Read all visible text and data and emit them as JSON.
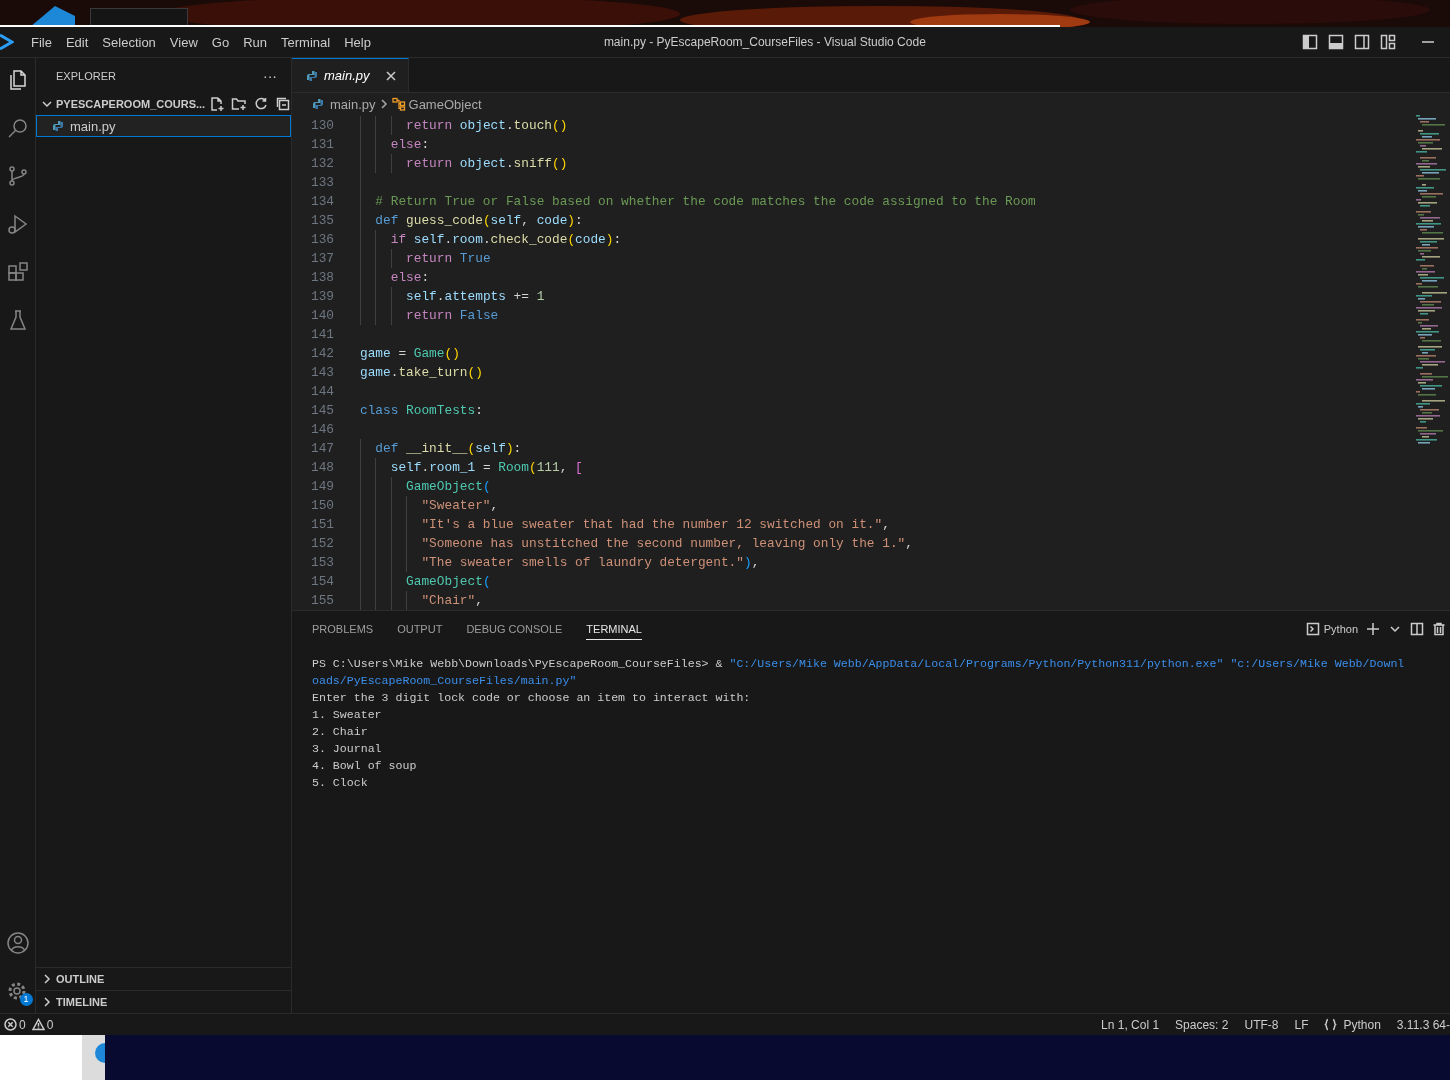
{
  "window": {
    "title": "main.py - PyEscapeRoom_CourseFiles - Visual Studio Code"
  },
  "menu": [
    "File",
    "Edit",
    "Selection",
    "View",
    "Go",
    "Run",
    "Terminal",
    "Help"
  ],
  "activity_bar": [
    {
      "selected": true
    },
    {
      "selected": false
    },
    {
      "selected": false
    },
    {
      "selected": false
    },
    {
      "selected": false
    },
    {
      "selected": false
    }
  ],
  "settings_badge": "1",
  "explorer": {
    "title": "EXPLORER",
    "more": "···",
    "folder": {
      "name": "PYESCAPEROOM_COURS...",
      "expanded": true
    },
    "files": [
      {
        "name": "main.py",
        "selected": true
      }
    ],
    "sections": [
      {
        "label": "OUTLINE",
        "expanded": false
      },
      {
        "label": "TIMELINE",
        "expanded": false
      }
    ]
  },
  "tabs": [
    {
      "label": "main.py",
      "selected": true
    }
  ],
  "breadcrumbs": [
    "main.py",
    "GameObject"
  ],
  "editor": {
    "lines": [
      {
        "n": "130",
        "tokens": [
          {
            "text": "      return ",
            "kind": "kw"
          },
          {
            "text": "object",
            "kind": "var"
          },
          {
            "text": ".",
            "kind": "p"
          },
          {
            "text": "touch",
            "kind": "fn"
          },
          {
            "text": "()",
            "kind": "br1"
          }
        ]
      },
      {
        "n": "131",
        "tokens": [
          {
            "text": "    else",
            "kind": "kw"
          },
          {
            "text": ":",
            "kind": "p"
          }
        ]
      },
      {
        "n": "132",
        "tokens": [
          {
            "text": "      return ",
            "kind": "kw"
          },
          {
            "text": "object",
            "kind": "var"
          },
          {
            "text": ".",
            "kind": "p"
          },
          {
            "text": "sniff",
            "kind": "fn"
          },
          {
            "text": "()",
            "kind": "br1"
          }
        ]
      },
      {
        "n": "133"
      },
      {
        "n": "134",
        "tokens": [
          {
            "text": "  # Return True or False based on whether the code matches the code assigned to the Room",
            "kind": "cmt"
          }
        ]
      },
      {
        "n": "135",
        "tokens": [
          {
            "text": "  def ",
            "kind": "kw2"
          },
          {
            "text": "guess_code",
            "kind": "fn"
          },
          {
            "text": "(",
            "kind": "br1"
          },
          {
            "text": "self",
            "kind": "var"
          },
          {
            "text": ", ",
            "kind": "p"
          },
          {
            "text": "code",
            "kind": "var"
          },
          {
            "text": ")",
            "kind": "br1"
          },
          {
            "text": ":",
            "kind": "p"
          }
        ]
      },
      {
        "n": "136",
        "tokens": [
          {
            "text": "    if ",
            "kind": "kw"
          },
          {
            "text": "self",
            "kind": "var"
          },
          {
            "text": ".",
            "kind": "p"
          },
          {
            "text": "room",
            "kind": "var"
          },
          {
            "text": ".",
            "kind": "p"
          },
          {
            "text": "check_code",
            "kind": "fn"
          },
          {
            "text": "(",
            "kind": "br1"
          },
          {
            "text": "code",
            "kind": "var"
          },
          {
            "text": ")",
            "kind": "br1"
          },
          {
            "text": ":",
            "kind": "p"
          }
        ]
      },
      {
        "n": "137",
        "tokens": [
          {
            "text": "      return ",
            "kind": "kw"
          },
          {
            "text": "True",
            "kind": "kw2"
          }
        ]
      },
      {
        "n": "138",
        "tokens": [
          {
            "text": "    else",
            "kind": "kw"
          },
          {
            "text": ":",
            "kind": "p"
          }
        ]
      },
      {
        "n": "139",
        "tokens": [
          {
            "text": "      self",
            "kind": "var"
          },
          {
            "text": ".",
            "kind": "p"
          },
          {
            "text": "attempts",
            "kind": "var"
          },
          {
            "text": " += ",
            "kind": "p"
          },
          {
            "text": "1",
            "kind": "num"
          }
        ]
      },
      {
        "n": "140",
        "tokens": [
          {
            "text": "      return ",
            "kind": "kw"
          },
          {
            "text": "False",
            "kind": "kw2"
          }
        ]
      },
      {
        "n": "141"
      },
      {
        "n": "142",
        "tokens": [
          {
            "text": "game",
            "kind": "var"
          },
          {
            "text": " = ",
            "kind": "p"
          },
          {
            "text": "Game",
            "kind": "cls"
          },
          {
            "text": "()",
            "kind": "br1"
          }
        ]
      },
      {
        "n": "143",
        "tokens": [
          {
            "text": "game",
            "kind": "var"
          },
          {
            "text": ".",
            "kind": "p"
          },
          {
            "text": "take_turn",
            "kind": "fn"
          },
          {
            "text": "()",
            "kind": "br1"
          }
        ]
      },
      {
        "n": "144"
      },
      {
        "n": "145",
        "tokens": [
          {
            "text": "class ",
            "kind": "kw2"
          },
          {
            "text": "RoomTests",
            "kind": "cls"
          },
          {
            "text": ":",
            "kind": "p"
          }
        ]
      },
      {
        "n": "146"
      },
      {
        "n": "147",
        "tokens": [
          {
            "text": "  def ",
            "kind": "kw2"
          },
          {
            "text": "__init__",
            "kind": "fn"
          },
          {
            "text": "(",
            "kind": "br1"
          },
          {
            "text": "self",
            "kind": "var"
          },
          {
            "text": ")",
            "kind": "br1"
          },
          {
            "text": ":",
            "kind": "p"
          }
        ]
      },
      {
        "n": "148",
        "tokens": [
          {
            "text": "    self",
            "kind": "var"
          },
          {
            "text": ".",
            "kind": "p"
          },
          {
            "text": "room_1",
            "kind": "var"
          },
          {
            "text": " = ",
            "kind": "p"
          },
          {
            "text": "Room",
            "kind": "cls"
          },
          {
            "text": "(",
            "kind": "br1"
          },
          {
            "text": "111",
            "kind": "num"
          },
          {
            "text": ", ",
            "kind": "p"
          },
          {
            "text": "[",
            "kind": "br2"
          }
        ]
      },
      {
        "n": "149",
        "tokens": [
          {
            "text": "      GameObject",
            "kind": "cls"
          },
          {
            "text": "(",
            "kind": "br3"
          }
        ]
      },
      {
        "n": "150",
        "tokens": [
          {
            "text": "        \"Sweater\"",
            "kind": "str"
          },
          {
            "text": ",",
            "kind": "p"
          }
        ]
      },
      {
        "n": "151",
        "tokens": [
          {
            "text": "        \"It's a blue sweater that had the number 12 switched on it.\"",
            "kind": "str"
          },
          {
            "text": ",",
            "kind": "p"
          }
        ]
      },
      {
        "n": "152",
        "tokens": [
          {
            "text": "        \"Someone has unstitched the second number, leaving only the 1.\"",
            "kind": "str"
          },
          {
            "text": ",",
            "kind": "p"
          }
        ]
      },
      {
        "n": "153",
        "tokens": [
          {
            "text": "        \"The sweater smells of laundry detergent.\"",
            "kind": "str"
          },
          {
            "text": ")",
            "kind": "br3"
          },
          {
            "text": ",",
            "kind": "p"
          }
        ]
      },
      {
        "n": "154",
        "tokens": [
          {
            "text": "      GameObject",
            "kind": "cls"
          },
          {
            "text": "(",
            "kind": "br3"
          }
        ]
      },
      {
        "n": "155",
        "tokens": [
          {
            "text": "        \"Chair\"",
            "kind": "str"
          },
          {
            "text": ",",
            "kind": "p"
          }
        ]
      }
    ]
  },
  "panel": {
    "tabs": [
      {
        "label": "PROBLEMS",
        "selected": false
      },
      {
        "label": "OUTPUT",
        "selected": false
      },
      {
        "label": "DEBUG CONSOLE",
        "selected": false
      },
      {
        "label": "TERMINAL",
        "selected": true
      }
    ],
    "terminal_profile": "Python",
    "terminal": [
      [
        {
          "text": "PS C:\\Users\\Mike Webb\\Downloads\\PyEscapeRoom_CourseFiles> & ",
          "kind": "plain"
        },
        {
          "text": "\"C:/Users/Mike Webb/AppData/Local/Programs/Python/Python311/python.exe\" \"c:/Users/Mike Webb/Downl",
          "kind": "path"
        }
      ],
      [
        {
          "text": "oads/PyEscapeRoom_CourseFiles/main.py\"",
          "kind": "path"
        }
      ],
      [
        {
          "text": "Enter the 3 digit lock code or choose an item to interact with:",
          "kind": "plain"
        }
      ],
      [
        {
          "text": "1. Sweater",
          "kind": "plain"
        }
      ],
      [
        {
          "text": "2. Chair",
          "kind": "plain"
        }
      ],
      [
        {
          "text": "3. Journal",
          "kind": "plain"
        }
      ],
      [
        {
          "text": "4. Bowl of soup",
          "kind": "plain"
        }
      ],
      [
        {
          "text": "5. Clock",
          "kind": "plain"
        }
      ]
    ]
  },
  "status_bar": {
    "errors": "0",
    "warnings": "0",
    "items": [
      {
        "text": "Ln 1, Col 1",
        "kind": "text"
      },
      {
        "text": "Spaces: 2",
        "kind": "text"
      },
      {
        "text": "UTF-8",
        "kind": "text"
      },
      {
        "text": "LF",
        "kind": "text"
      },
      {
        "text": "Python",
        "kind": "language"
      },
      {
        "text": "3.11.3 64-",
        "kind": "text"
      }
    ]
  }
}
